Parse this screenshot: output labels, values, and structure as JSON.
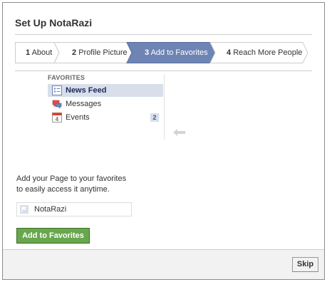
{
  "dialog": {
    "title": "Set Up NotaRazi"
  },
  "steps": [
    {
      "num": "1",
      "label": "About",
      "active": false
    },
    {
      "num": "2",
      "label": "Profile Picture",
      "active": false
    },
    {
      "num": "3",
      "label": "Add to Favorites",
      "active": true
    },
    {
      "num": "4",
      "label": "Reach More People",
      "active": false
    }
  ],
  "favorites": {
    "header": "FAVORITES",
    "items": [
      {
        "label": "News Feed",
        "icon": "news-feed-icon",
        "selected": true
      },
      {
        "label": "Messages",
        "icon": "messages-icon",
        "selected": false
      },
      {
        "label": "Events",
        "icon": "calendar-icon",
        "icon_text": "4",
        "count": "2",
        "selected": false
      }
    ]
  },
  "description": {
    "line1": "Add your Page to your favorites",
    "line2": "to easily access it anytime."
  },
  "page": {
    "name": "NotaRazi",
    "icon": "flag-icon"
  },
  "actions": {
    "add_label": "Add to Favorites",
    "skip_label": "Skip"
  },
  "colors": {
    "active_step": "#6d84b4",
    "add_button": "#69a74e",
    "selected_item": "#d8dfea"
  }
}
